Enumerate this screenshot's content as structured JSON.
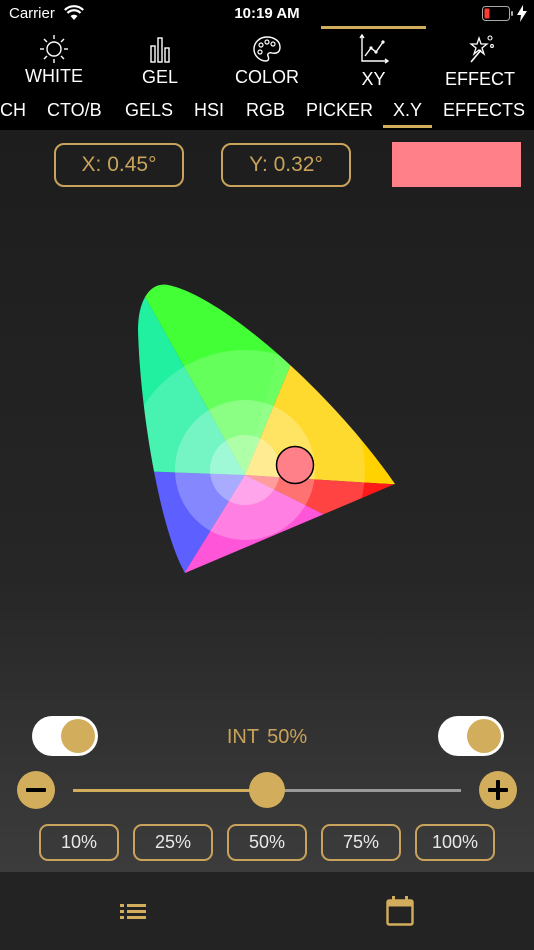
{
  "status_bar": {
    "carrier": "Carrier",
    "time": "10:19 AM"
  },
  "main_tabs": [
    {
      "label": "WHITE",
      "icon": "sun-icon"
    },
    {
      "label": "GEL",
      "icon": "bars-icon"
    },
    {
      "label": "COLOR",
      "icon": "palette-icon"
    },
    {
      "label": "XY",
      "icon": "xy-graph-icon",
      "active": true
    },
    {
      "label": "EFFECT",
      "icon": "magic-wand-icon"
    }
  ],
  "sub_tabs": [
    {
      "label": "CH"
    },
    {
      "label": "CTO/B"
    },
    {
      "label": "GELS"
    },
    {
      "label": "HSI"
    },
    {
      "label": "RGB"
    },
    {
      "label": "PICKER"
    },
    {
      "label": "X.Y",
      "active": true
    },
    {
      "label": "EFFECTS"
    }
  ],
  "xy": {
    "x_label": "X: 0.45°",
    "y_label": "Y: 0.32°",
    "x_value": 0.45,
    "y_value": 0.32,
    "swatch_color": "#ff8088"
  },
  "intensity": {
    "label": "INT",
    "value": "50%",
    "level": 0.5
  },
  "presets": [
    "10%",
    "25%",
    "50%",
    "75%",
    "100%"
  ],
  "bottom_bar": {
    "left_icon": "list-icon",
    "right_icon": "calendar-icon"
  },
  "colors": {
    "accent": "#d2ad5c",
    "background": "#000000"
  }
}
